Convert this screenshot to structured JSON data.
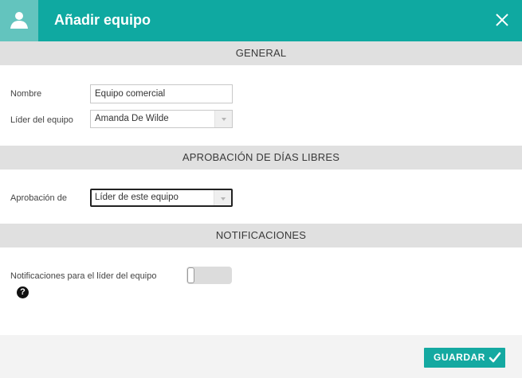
{
  "header": {
    "title": "Añadir equipo",
    "user_icon": "user-icon",
    "close_icon": "close-icon"
  },
  "sections": {
    "general": "GENERAL",
    "approval": "APROBACIÓN DE DÍAS LIBRES",
    "notifications": "NOTIFICACIONES"
  },
  "form": {
    "name_label": "Nombre",
    "name_value": "Equipo comercial",
    "leader_label": "Líder del equipo",
    "leader_value": "Amanda De Wilde",
    "approval_label": "Aprobación de",
    "approval_value": "Líder de este equipo",
    "notify_label": "Notificaciones para el líder del equipo",
    "notify_enabled": false,
    "help_symbol": "?"
  },
  "footer": {
    "save_label": "GUARDAR",
    "save_icon": "check-icon"
  },
  "colors": {
    "accent": "#0fa9a1",
    "accent_light": "#63c4be",
    "section_bg": "#e0e0e0",
    "footer_bg": "#f3f3f3"
  }
}
